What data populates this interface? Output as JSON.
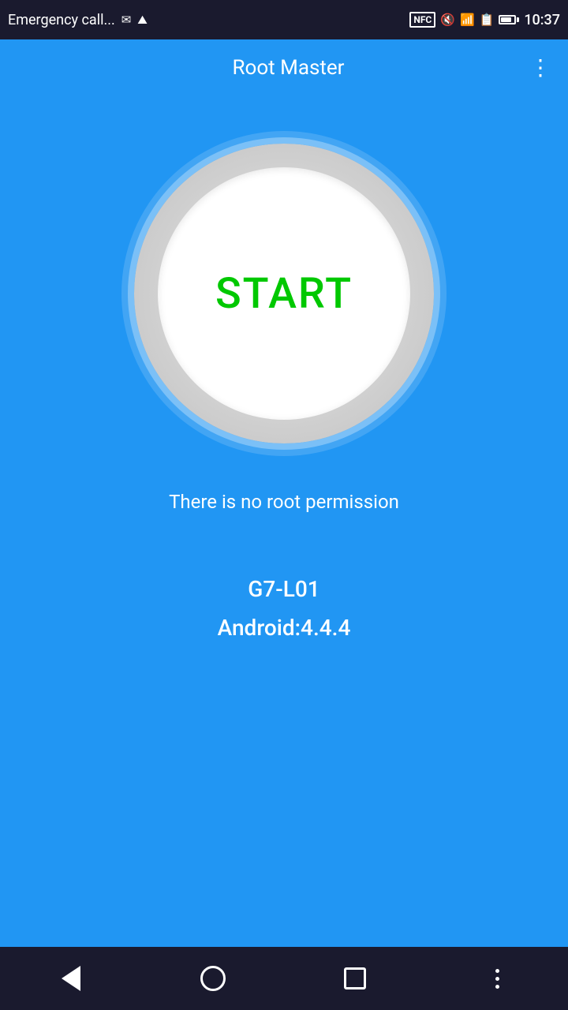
{
  "statusBar": {
    "emergencyText": "Emergency call...",
    "time": "10:37",
    "nfcLabel": "NFC"
  },
  "appBar": {
    "title": "Root Master",
    "moreMenuLabel": "More options"
  },
  "main": {
    "startButtonLabel": "START",
    "statusMessage": "There is no root permission",
    "deviceModel": "G7-L01",
    "androidVersion": "Android:4.4.4"
  },
  "navBar": {
    "backLabel": "Back",
    "homeLabel": "Home",
    "recentsLabel": "Recents",
    "moreLabel": "More"
  },
  "colors": {
    "background": "#2196f3",
    "statusBar": "#1a1a2e",
    "startText": "#00c800",
    "white": "#ffffff"
  }
}
